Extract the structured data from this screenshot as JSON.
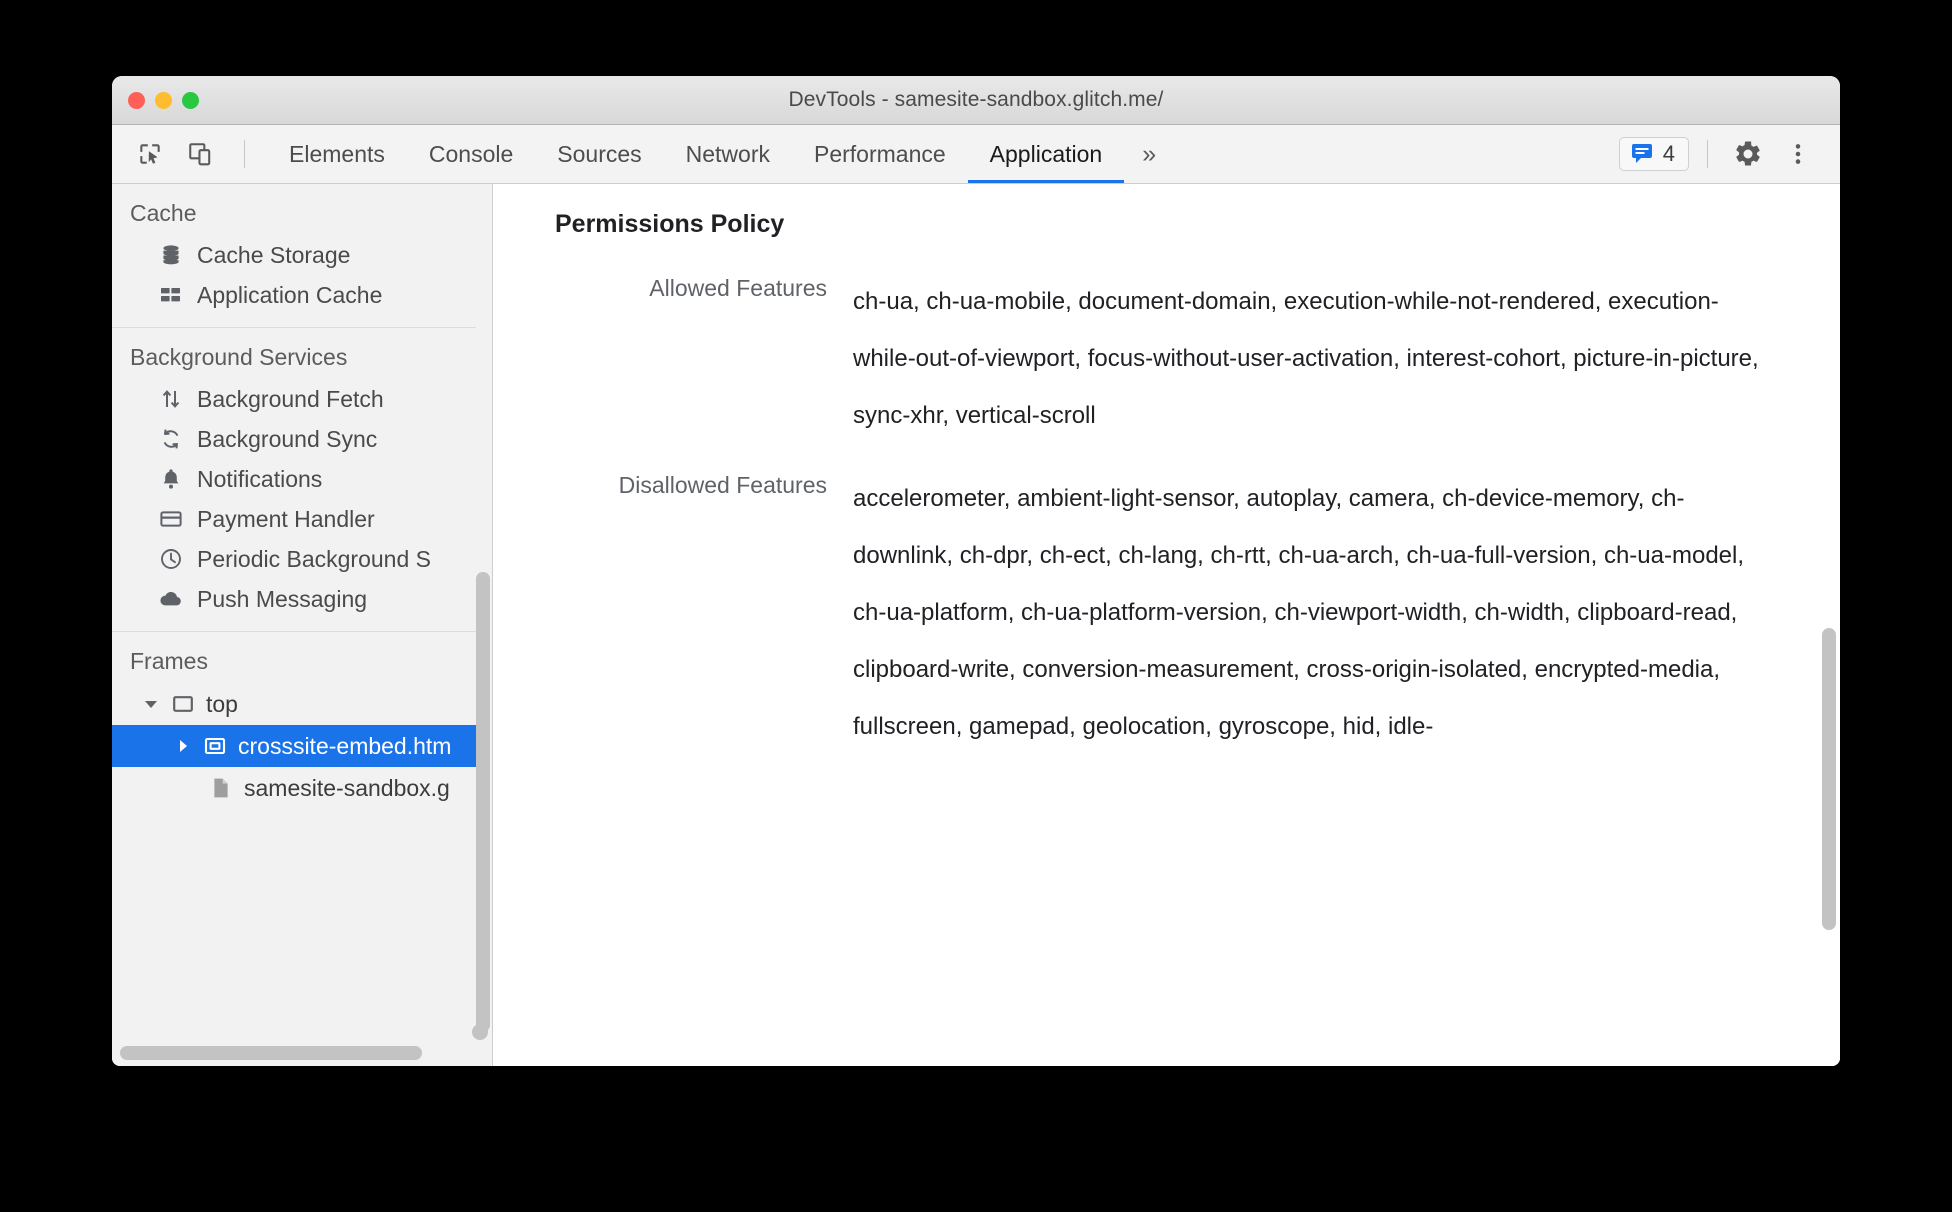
{
  "window": {
    "title": "DevTools - samesite-sandbox.glitch.me/",
    "traffic_lights": {
      "close": "close-window-button",
      "minimize": "minimize-window-button",
      "maximize": "maximize-window-button"
    }
  },
  "toolbar": {
    "inspect_icon": "inspect-element-icon",
    "device_icon": "device-toolbar-icon",
    "tabs": [
      {
        "label": "Elements",
        "active": false
      },
      {
        "label": "Console",
        "active": false
      },
      {
        "label": "Sources",
        "active": false
      },
      {
        "label": "Network",
        "active": false
      },
      {
        "label": "Performance",
        "active": false
      },
      {
        "label": "Application",
        "active": true
      }
    ],
    "more_tabs_label": "»",
    "issues": {
      "icon": "issues-message-icon",
      "count": "4",
      "accent_color": "#1a73e8"
    },
    "settings_icon": "gear-icon",
    "kebab_icon": "more-options-icon",
    "active_tab_underline_color": "#1a73e8"
  },
  "sidebar": {
    "groups": [
      {
        "title": "Cache",
        "items": [
          {
            "label": "Cache Storage",
            "icon": "database-icon"
          },
          {
            "label": "Application Cache",
            "icon": "grid-icon"
          }
        ]
      },
      {
        "title": "Background Services",
        "items": [
          {
            "label": "Background Fetch",
            "icon": "arrows-up-down-icon"
          },
          {
            "label": "Background Sync",
            "icon": "sync-icon"
          },
          {
            "label": "Notifications",
            "icon": "bell-icon"
          },
          {
            "label": "Payment Handler",
            "icon": "credit-card-icon"
          },
          {
            "label": "Periodic Background S",
            "icon": "clock-icon"
          },
          {
            "label": "Push Messaging",
            "icon": "cloud-icon"
          }
        ]
      }
    ],
    "frames": {
      "title": "Frames",
      "tree": [
        {
          "label": "top",
          "icon": "frame-icon",
          "arrow": "expanded",
          "level": 1,
          "selected": false
        },
        {
          "label": "crosssite-embed.htm",
          "icon": "iframe-icon",
          "arrow": "collapsed",
          "level": 2,
          "selected": true
        },
        {
          "label": "samesite-sandbox.g",
          "icon": "document-icon",
          "arrow": "none",
          "level": 2,
          "selected": false
        }
      ]
    },
    "selection_color": "#1a73e8",
    "scrollbar": {
      "vertical": "sidebar-vertical-scrollbar",
      "horizontal": "sidebar-horizontal-scrollbar"
    }
  },
  "main": {
    "heading": "Permissions Policy",
    "rows": [
      {
        "key": "Allowed Features",
        "value": "ch-ua, ch-ua-mobile, document-domain, execution-while-not-rendered, execution-while-out-of-viewport, focus-without-user-activation, interest-cohort, picture-in-picture, sync-xhr, vertical-scroll"
      },
      {
        "key": "Disallowed Features",
        "value": "accelerometer, ambient-light-sensor, autoplay, camera, ch-device-memory, ch-downlink, ch-dpr, ch-ect, ch-lang, ch-rtt, ch-ua-arch, ch-ua-full-version, ch-ua-model, ch-ua-platform, ch-ua-platform-version, ch-viewport-width, ch-width, clipboard-read, clipboard-write, conversion-measurement, cross-origin-isolated, encrypted-media, fullscreen, gamepad, geolocation, gyroscope, hid, idle-"
      }
    ],
    "scrollbar": "main-vertical-scrollbar"
  }
}
